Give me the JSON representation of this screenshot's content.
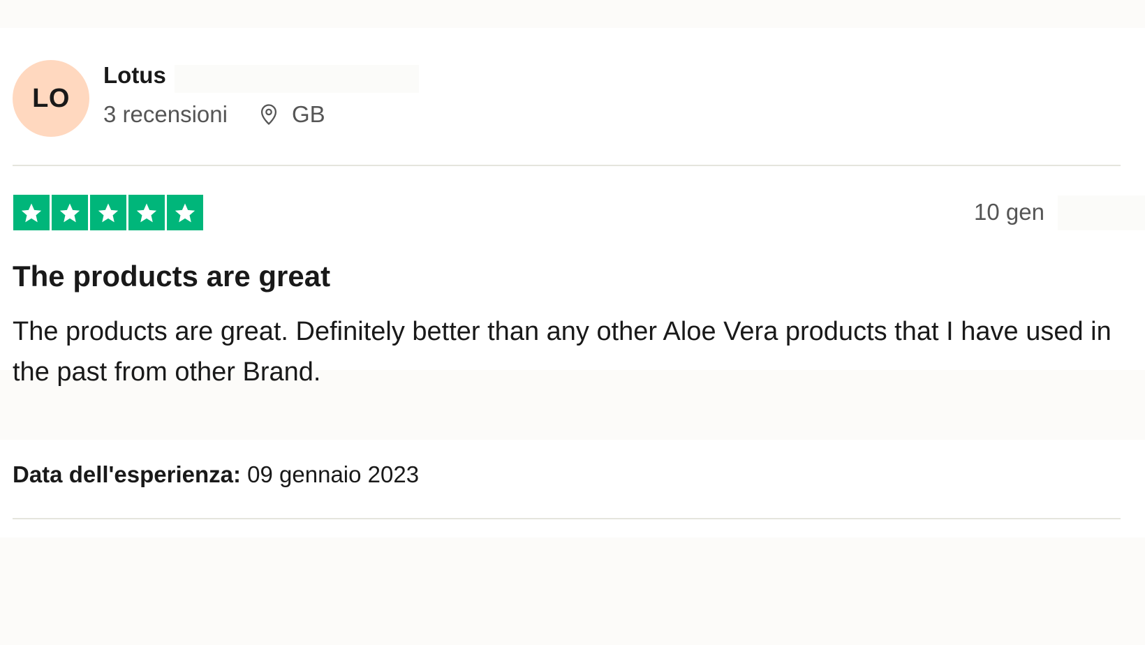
{
  "reviewer": {
    "initials": "LO",
    "name": "Lotus",
    "review_count": "3 recensioni",
    "country": "GB"
  },
  "review": {
    "rating": 5,
    "date": "10 gen",
    "title": "The products are great",
    "body": "The products are great. Definitely better than any other Aloe Vera products that I have used in the past from other Brand.",
    "experience_label": "Data dell'esperienza:",
    "experience_date": "09 gennaio 2023"
  },
  "colors": {
    "star_green": "#00b67a",
    "avatar_bg": "#ffd8bf",
    "text_primary": "#191919",
    "text_secondary": "#555555"
  },
  "icons": {
    "location": "location-pin-icon",
    "star": "star-icon"
  }
}
